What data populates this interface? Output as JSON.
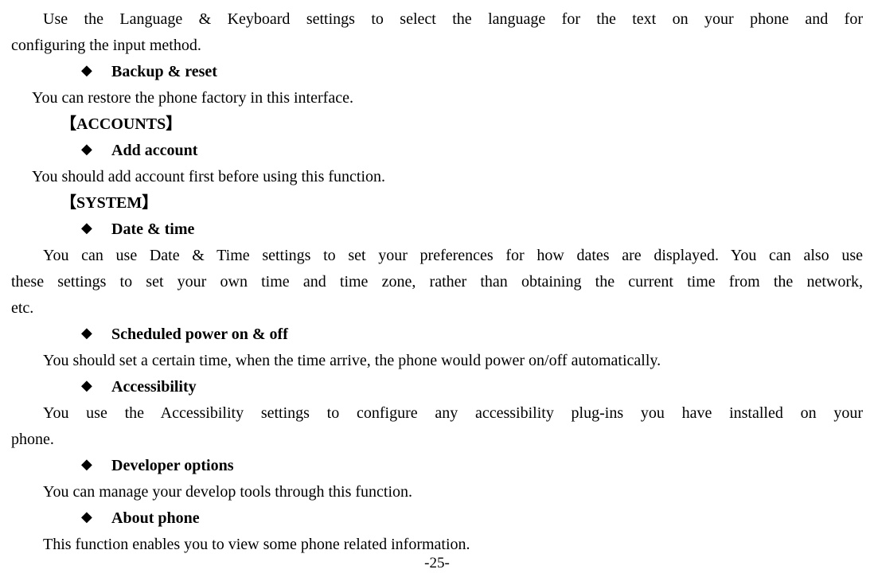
{
  "intro": {
    "line1": "Use the Language & Keyboard settings to select the language for the text on your phone and for",
    "line2": "configuring the input method."
  },
  "backup": {
    "title": "Backup & reset",
    "desc": "You can restore the phone factory in this interface."
  },
  "accounts_header": "【ACCOUNTS】",
  "add_account": {
    "title": "Add account",
    "desc": "You should add account first before using this function."
  },
  "system_header": "【SYSTEM】",
  "datetime": {
    "title": "Date & time",
    "line1": "You can use Date & Time settings to set your preferences for how dates are displayed. You can also use",
    "line2": "these settings to set your own time and time zone, rather than obtaining the current time from the network,",
    "line3": "etc."
  },
  "scheduled": {
    "title": "Scheduled power on & off",
    "desc": "You should set a certain time, when the time arrive, the phone would power on/off automatically."
  },
  "accessibility": {
    "title": "Accessibility",
    "line1": "You use the Accessibility settings to configure any accessibility plug-ins you have installed on your",
    "line2": "phone."
  },
  "developer": {
    "title": "Developer options",
    "desc": "You can manage your develop tools through this function."
  },
  "about": {
    "title": "About phone",
    "desc": "This function enables you to view some phone related information."
  },
  "page_number": "-25-",
  "bullet_char": "◆"
}
